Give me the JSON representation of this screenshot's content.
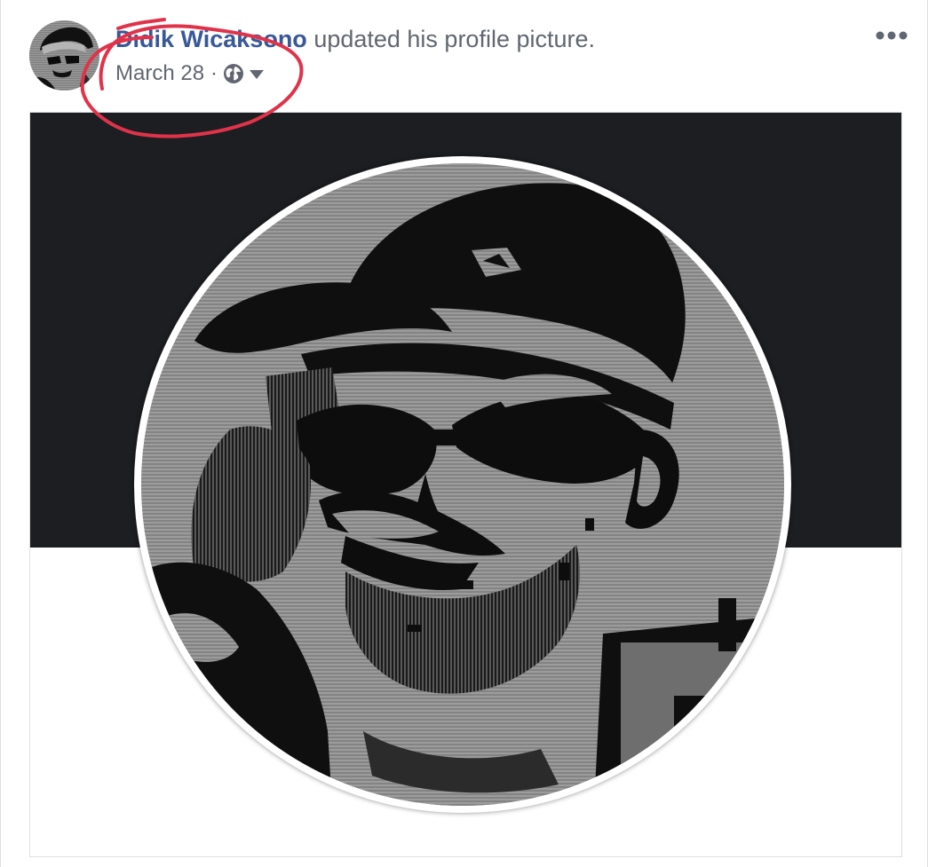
{
  "post": {
    "author_name": "Didik Wicaksono",
    "action_text": " updated his profile picture.",
    "timestamp": "March 28",
    "separator": "·",
    "audience_icon": "globe-icon",
    "audience_menu_icon": "caret-down-icon",
    "more_options_icon": "more-options-icon"
  },
  "colors": {
    "author_link": "#385898",
    "meta_text": "#606770",
    "annotation": "#e0334a",
    "cover_band": "#1d1e22"
  }
}
